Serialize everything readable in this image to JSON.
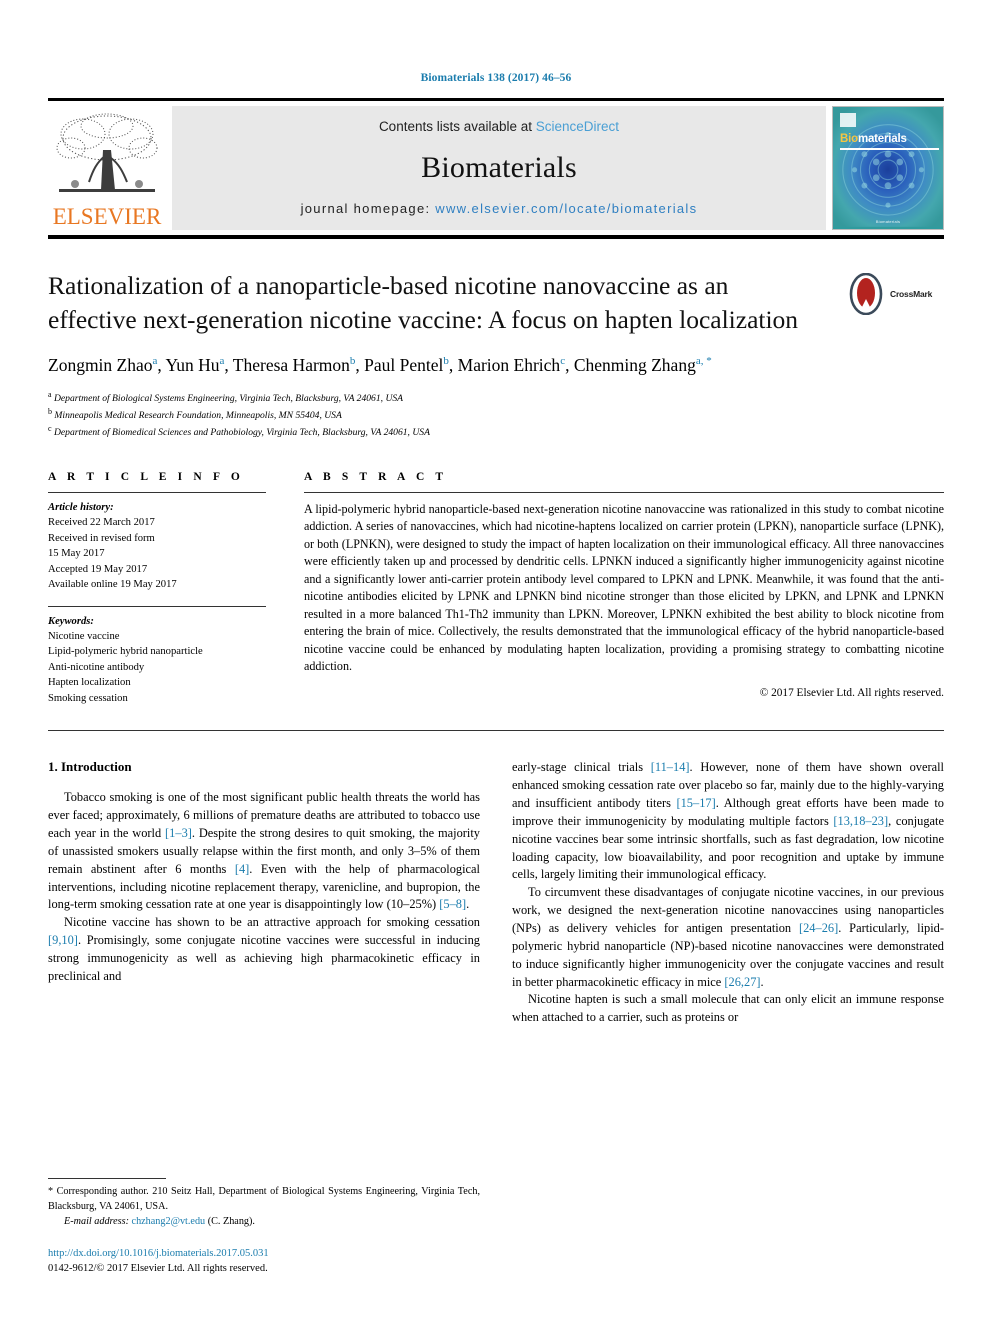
{
  "running_head": "Biomaterials 138 (2017) 46–56",
  "masthead": {
    "elsevier_word": "ELSEVIER",
    "contents_prefix": "Contents lists available at ",
    "contents_link": "ScienceDirect",
    "journal_name": "Biomaterials",
    "homepage_prefix": "journal homepage: ",
    "homepage_url": "www.elsevier.com/locate/biomaterials",
    "cover_title_accent": "Bio",
    "cover_title_rest": "materials",
    "cover_footer": "Biomaterials"
  },
  "title": "Rationalization of a nanoparticle-based nicotine nanovaccine as an effective next-generation nicotine vaccine: A focus on hapten localization",
  "crossmark_label": "CrossMark",
  "authors": [
    {
      "name": "Zongmin Zhao",
      "mark": "a",
      "sep": ", "
    },
    {
      "name": "Yun Hu",
      "mark": "a",
      "sep": ", "
    },
    {
      "name": "Theresa Harmon",
      "mark": "b",
      "sep": ", "
    },
    {
      "name": "Paul Pentel",
      "mark": "b",
      "sep": ", "
    },
    {
      "name": "Marion Ehrich",
      "mark": "c",
      "sep": ", "
    },
    {
      "name": "Chenming Zhang",
      "mark": "a, *",
      "sep": ""
    }
  ],
  "affiliations": [
    {
      "mark": "a",
      "text": "Department of Biological Systems Engineering, Virginia Tech, Blacksburg, VA 24061, USA"
    },
    {
      "mark": "b",
      "text": "Minneapolis Medical Research Foundation, Minneapolis, MN 55404, USA"
    },
    {
      "mark": "c",
      "text": "Department of Biomedical Sciences and Pathobiology, Virginia Tech, Blacksburg, VA 24061, USA"
    }
  ],
  "article_info": {
    "heading": "A R T I C L E  I N F O",
    "history_label": "Article history:",
    "history": [
      "Received 22 March 2017",
      "Received in revised form",
      "15 May 2017",
      "Accepted 19 May 2017",
      "Available online 19 May 2017"
    ],
    "keywords_label": "Keywords:",
    "keywords": [
      "Nicotine vaccine",
      "Lipid-polymeric hybrid nanoparticle",
      "Anti-nicotine antibody",
      "Hapten localization",
      "Smoking cessation"
    ]
  },
  "abstract": {
    "heading": "A B S T R A C T",
    "text": "A lipid-polymeric hybrid nanoparticle-based next-generation nicotine nanovaccine was rationalized in this study to combat nicotine addiction. A series of nanovaccines, which had nicotine-haptens localized on carrier protein (LPKN), nanoparticle surface (LPNK), or both (LPNKN), were designed to study the impact of hapten localization on their immunological efficacy. All three nanovaccines were efficiently taken up and processed by dendritic cells. LPNKN induced a significantly higher immunogenicity against nicotine and a significantly lower anti-carrier protein antibody level compared to LPKN and LPNK. Meanwhile, it was found that the anti-nicotine antibodies elicited by LPNK and LPNKN bind nicotine stronger than those elicited by LPKN, and LPNK and LPNKN resulted in a more balanced Th1-Th2 immunity than LPKN. Moreover, LPNKN exhibited the best ability to block nicotine from entering the brain of mice. Collectively, the results demonstrated that the immunological efficacy of the hybrid nanoparticle-based nicotine vaccine could be enhanced by modulating hapten localization, providing a promising strategy to combatting nicotine addiction.",
    "copyright": "© 2017 Elsevier Ltd. All rights reserved."
  },
  "introduction": {
    "heading": "1. Introduction",
    "left_paragraphs": [
      "Tobacco smoking is one of the most significant public health threats the world has ever faced; approximately, 6 millions of premature deaths are attributed to tobacco use each year in the world [1–3]. Despite the strong desires to quit smoking, the majority of unassisted smokers usually relapse within the first month, and only 3–5% of them remain abstinent after 6 months [4]. Even with the help of pharmacological interventions, including nicotine replacement therapy, varenicline, and bupropion, the long-term smoking cessation rate at one year is disappointingly low (10–25%) [5–8].",
      "Nicotine vaccine has shown to be an attractive approach for smoking cessation [9,10]. Promisingly, some conjugate nicotine vaccines were successful in inducing strong immunogenicity as well as achieving high pharmacokinetic efficacy in preclinical and"
    ],
    "right_paragraphs": [
      "early-stage clinical trials [11–14]. However, none of them have shown overall enhanced smoking cessation rate over placebo so far, mainly due to the highly-varying and insufficient antibody titers [15–17]. Although great efforts have been made to improve their immunogenicity by modulating multiple factors [13,18–23], conjugate nicotine vaccines bear some intrinsic shortfalls, such as fast degradation, low nicotine loading capacity, low bioavailability, and poor recognition and uptake by immune cells, largely limiting their immunological efficacy.",
      "To circumvent these disadvantages of conjugate nicotine vaccines, in our previous work, we designed the next-generation nicotine nanovaccines using nanoparticles (NPs) as delivery vehicles for antigen presentation [24–26]. Particularly, lipid-polymeric hybrid nanoparticle (NP)-based nicotine nanovaccines were demonstrated to induce significantly higher immunogenicity over the conjugate vaccines and result in better pharmacokinetic efficacy in mice [26,27].",
      "Nicotine hapten is such a small molecule that can only elicit an immune response when attached to a carrier, such as proteins or"
    ]
  },
  "footnote": {
    "marker": "*",
    "text": "Corresponding author. 210 Seitz Hall, Department of Biological Systems Engineering, Virginia Tech, Blacksburg, VA 24061, USA.",
    "email_label": "E-mail address:",
    "email": "chzhang2@vt.edu",
    "email_suffix": "(C. Zhang)."
  },
  "doi": {
    "url": "http://dx.doi.org/10.1016/j.biomaterials.2017.05.031",
    "issn_line": "0142-9612/© 2017 Elsevier Ltd. All rights reserved."
  },
  "colors": {
    "link_blue": "#1a7cad",
    "elsevier_orange": "#e87722",
    "cover_teal": "#2f9b9e"
  }
}
